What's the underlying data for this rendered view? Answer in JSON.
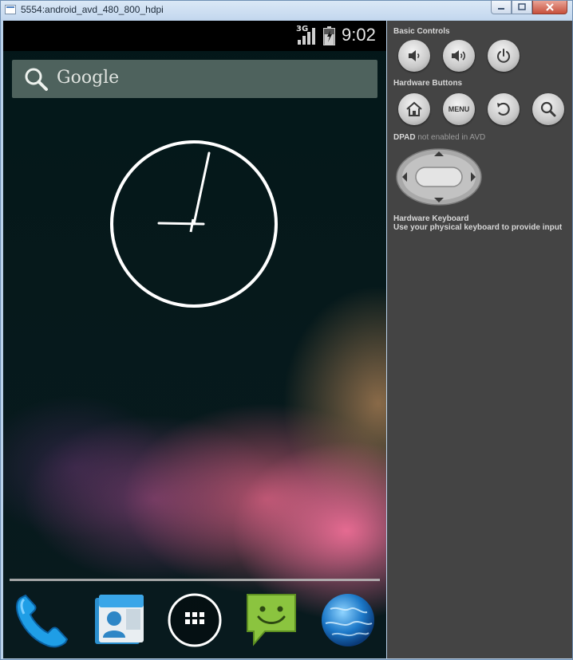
{
  "window": {
    "title": "5554:android_avd_480_800_hdpi",
    "controls": [
      "minimize",
      "maximize",
      "close"
    ]
  },
  "statusbar": {
    "network": "3G",
    "time": "9:02"
  },
  "search": {
    "label": "Google"
  },
  "dock": {
    "items": [
      "phone",
      "contacts",
      "all-apps",
      "messaging",
      "browser"
    ]
  },
  "panel": {
    "basic_controls_title": "Basic Controls",
    "hardware_buttons_title": "Hardware Buttons",
    "menu_label": "MENU",
    "dpad_title": "DPAD",
    "dpad_note": "not enabled in AVD",
    "keyboard_title": "Hardware Keyboard",
    "keyboard_note": "Use your physical keyboard to provide input"
  },
  "colors": {
    "panel_bg": "#444444",
    "screen_bg": "#041b1e",
    "titlebar": "#c3d7ee",
    "close_button": "#c7503c"
  }
}
